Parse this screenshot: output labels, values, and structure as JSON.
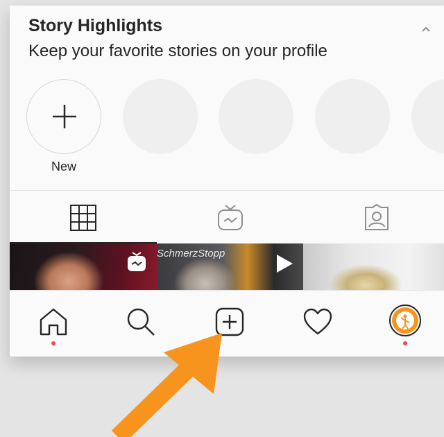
{
  "highlights": {
    "title": "Story Highlights",
    "subtitle": "Keep your favorite stories on your profile",
    "new_label": "New"
  },
  "tabs": [
    {
      "icon": "grid-icon",
      "active": true
    },
    {
      "icon": "igtv-icon",
      "active": false
    },
    {
      "icon": "tagged-icon",
      "active": false
    }
  ],
  "grid": [
    {
      "badge": "igtv-badge-icon"
    },
    {
      "text": "SchmerzStopp",
      "badge": "play-icon"
    },
    {
      "badge": null
    }
  ],
  "bottom_nav": [
    "home-icon",
    "search-icon",
    "new-post-icon",
    "heart-icon",
    "profile-avatar"
  ],
  "colors": {
    "arrow": "#f7941d",
    "notification_dot": "#ed4956",
    "background": "#e4e4e4"
  }
}
